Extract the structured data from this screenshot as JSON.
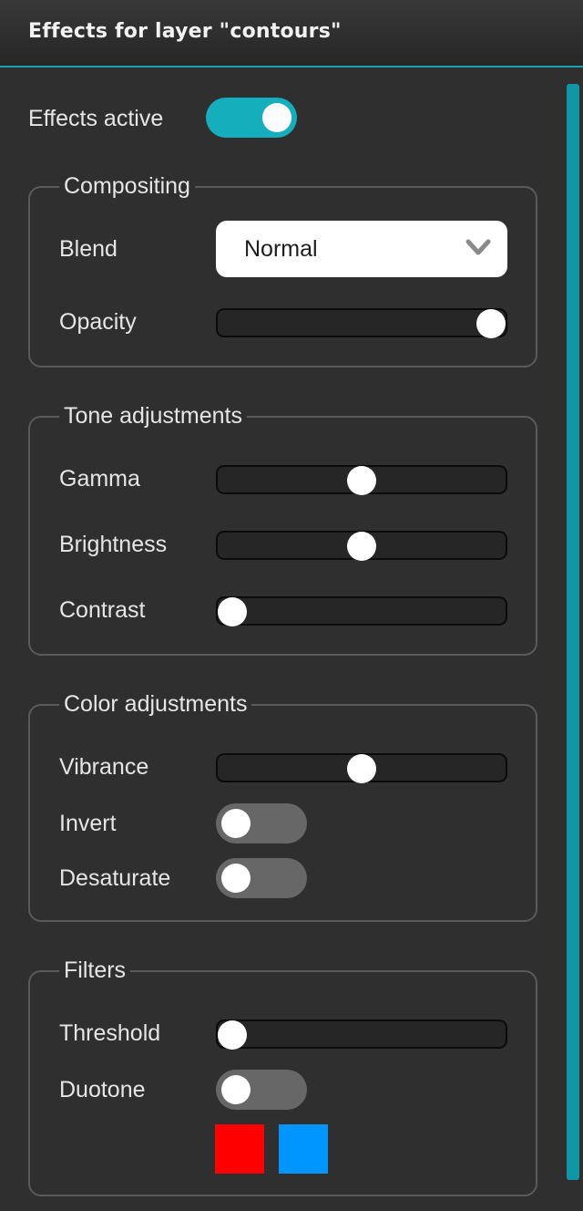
{
  "header": {
    "title": "Effects for layer \"contours\""
  },
  "effects_active": {
    "label": "Effects active",
    "on": true
  },
  "compositing": {
    "legend": "Compositing",
    "blend": {
      "label": "Blend",
      "value": "Normal"
    },
    "opacity": {
      "label": "Opacity",
      "value": 1.0
    }
  },
  "tone": {
    "legend": "Tone adjustments",
    "gamma": {
      "label": "Gamma",
      "value": 0.5
    },
    "brightness": {
      "label": "Brightness",
      "value": 0.5
    },
    "contrast": {
      "label": "Contrast",
      "value": 0.0
    }
  },
  "color": {
    "legend": "Color adjustments",
    "vibrance": {
      "label": "Vibrance",
      "value": 0.5
    },
    "invert": {
      "label": "Invert",
      "on": false
    },
    "desaturate": {
      "label": "Desaturate",
      "on": false
    }
  },
  "filters": {
    "legend": "Filters",
    "threshold": {
      "label": "Threshold",
      "value": 0.0
    },
    "duotone": {
      "label": "Duotone",
      "on": false,
      "colors": [
        "#ff0000",
        "#0096ff"
      ]
    }
  },
  "theme": {
    "accent": "#14aebc",
    "background": "#2f2f2f"
  }
}
